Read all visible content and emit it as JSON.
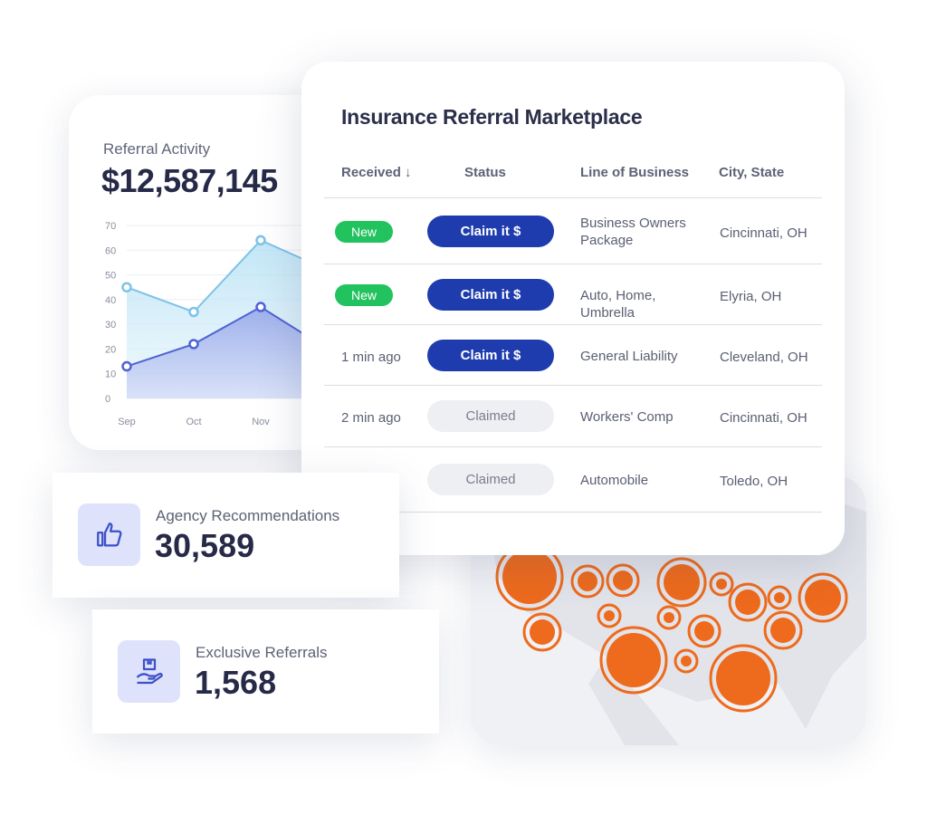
{
  "activity": {
    "label": "Referral Activity",
    "total": "$12,587,145"
  },
  "chart_data": {
    "type": "area",
    "categories": [
      "Sep",
      "Oct",
      "Nov",
      ""
    ],
    "y_ticks": [
      "0",
      "10",
      "20",
      "30",
      "40",
      "50",
      "60",
      "70"
    ],
    "ylim": [
      0,
      70
    ],
    "grid": true,
    "series": [
      {
        "values": [
          45,
          35,
          64,
          52
        ],
        "color": "#7cc3e8"
      },
      {
        "values": [
          13,
          22,
          37,
          20
        ],
        "color": "#4f62d4"
      }
    ]
  },
  "marketplace": {
    "title": "Insurance Referral Marketplace",
    "columns": [
      "Received ↓",
      "Status",
      "Line of Business",
      "City, State"
    ],
    "rows": [
      {
        "received": "New",
        "received_type": "badge",
        "status": "Claim it $",
        "status_type": "claim",
        "line": "Business Owners Package",
        "city": "Cincinnati, OH"
      },
      {
        "received": "New",
        "received_type": "badge",
        "status": "Claim it $",
        "status_type": "claim",
        "line": "Auto, Home, Umbrella",
        "city": "Elyria, OH"
      },
      {
        "received": "1 min ago",
        "received_type": "text",
        "status": "Claim it $",
        "status_type": "claim",
        "line": "General Liability",
        "city": "Cleveland, OH"
      },
      {
        "received": "2 min ago",
        "received_type": "text",
        "status": "Claimed",
        "status_type": "claimed",
        "line": "Workers' Comp",
        "city": "Cincinnati, OH"
      },
      {
        "received": "",
        "received_type": "text",
        "status": "Claimed",
        "status_type": "claimed",
        "line": "Automobile",
        "city": "Toledo, OH"
      }
    ]
  },
  "stats": {
    "agency": {
      "label": "Agency Recommendations",
      "value": "30,589",
      "icon": "thumbs-up-icon"
    },
    "exclusive": {
      "label": "Exclusive Referrals",
      "value": "1,568",
      "icon": "hand-package-icon"
    }
  },
  "colors": {
    "primary": "#1f3cae",
    "new": "#22c35e",
    "map_marker": "#ee6a1c"
  }
}
